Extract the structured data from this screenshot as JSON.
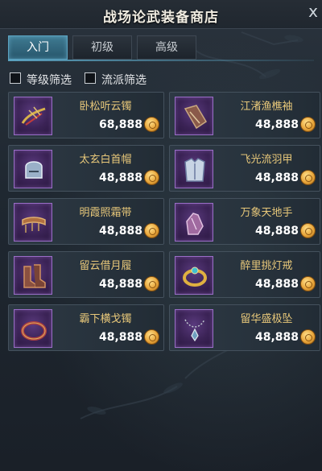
{
  "window": {
    "title": "战场论武装备商店",
    "close_glyph": "x"
  },
  "tabs": [
    {
      "label": "入门",
      "active": true
    },
    {
      "label": "初级",
      "active": false
    },
    {
      "label": "高级",
      "active": false
    }
  ],
  "filters": [
    {
      "label": "等级筛选",
      "checked": false
    },
    {
      "label": "流派筛选",
      "checked": false
    }
  ],
  "items": [
    {
      "name": "卧松听云镯",
      "price": "68,888",
      "icon": "bracelet-feather-icon"
    },
    {
      "name": "江渚渔樵袖",
      "price": "48,888",
      "icon": "sleeve-armor-icon"
    },
    {
      "name": "太玄白首帽",
      "price": "48,888",
      "icon": "helmet-icon"
    },
    {
      "name": "飞光流羽甲",
      "price": "48,888",
      "icon": "chest-armor-icon"
    },
    {
      "name": "明霞照霜带",
      "price": "48,888",
      "icon": "belt-icon"
    },
    {
      "name": "万象天地手",
      "price": "48,888",
      "icon": "glove-icon"
    },
    {
      "name": "留云借月履",
      "price": "48,888",
      "icon": "boots-icon"
    },
    {
      "name": "醉里挑灯戒",
      "price": "48,888",
      "icon": "ring-icon"
    },
    {
      "name": "霸下横戈镯",
      "price": "48,888",
      "icon": "bangle-icon"
    },
    {
      "name": "留华盛极坠",
      "price": "48,888",
      "icon": "pendant-icon"
    }
  ],
  "colors": {
    "item_name": "#e8c87a",
    "icon_frame": "#9a6ec7",
    "active_tab": "#3f7a92",
    "price": "#ffffff"
  }
}
